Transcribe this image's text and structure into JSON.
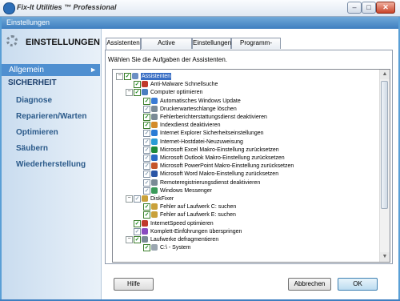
{
  "window": {
    "title": "Fix-It Utilities ™ Professional"
  },
  "window_buttons": {
    "minimize": "–",
    "maximize": "□",
    "close": "✕"
  },
  "settings_bar": {
    "title": "Einstellungen"
  },
  "sidebar": {
    "header": "EINSTELLUNGEN",
    "selected": "Allgemein",
    "section": "SICHERHEIT",
    "items": [
      "Diagnose",
      "Reparieren/Warten",
      "Optimieren",
      "Säubern",
      "Wiederherstellung"
    ]
  },
  "tabs": [
    "Assistenten",
    "Active Intelligence",
    "Einstellungen",
    "Programm-Update"
  ],
  "active_tab": "Assistenten",
  "instruction": "Wählen Sie die Aufgaben der Assistenten.",
  "tree": [
    {
      "label": "Assistenten",
      "selected": true
    },
    {
      "label": "Anti-Malware Schnellsuche"
    },
    {
      "label": "Computer optimieren"
    },
    {
      "label": "Automatisches Windows Update"
    },
    {
      "label": "Druckerwarteschlange löschen"
    },
    {
      "label": "Fehlerberichterstattungsdienst deaktivieren"
    },
    {
      "label": "Indexdienst deaktivieren"
    },
    {
      "label": "Internet Explorer Sicherheitseinstellungen"
    },
    {
      "label": "Internet-Hostdatei-Neuzuweisung"
    },
    {
      "label": "Microsoft Excel Makro-Einstellung zurücksetzen"
    },
    {
      "label": "Microsoft Outlook Makro-Einstellung zurücksetzen"
    },
    {
      "label": "Microsoft PowerPoint Makro-Einstellung zurücksetzen"
    },
    {
      "label": "Microsoft Word Makro-Einstellung zurücksetzen"
    },
    {
      "label": "Remoteregistrierungsdienst deaktivieren"
    },
    {
      "label": "Windows Messenger"
    },
    {
      "label": "DiskFixer"
    },
    {
      "label": "Fehler auf Laufwerk C: suchen"
    },
    {
      "label": "Fehler auf Laufwerk E: suchen"
    },
    {
      "label": "InternetSpeed optimieren"
    },
    {
      "label": "Komplett-Einführungen überspringen"
    },
    {
      "label": "Laufwerke defragmentieren"
    },
    {
      "label": "C:\\ - System"
    }
  ],
  "buttons": {
    "help": "Hilfe",
    "cancel": "Abbrechen",
    "ok": "OK"
  },
  "colors": {
    "accent": "#4f8fd0",
    "checkmark": "#1c8a1c",
    "selection": "#3a6fc4"
  }
}
